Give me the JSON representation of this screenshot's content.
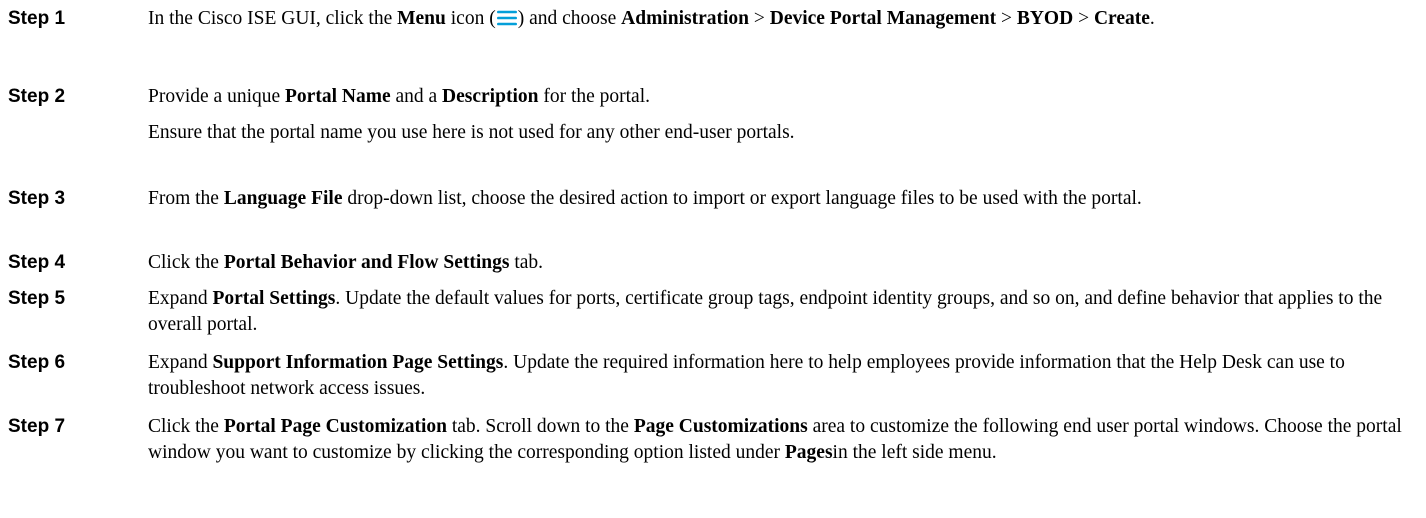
{
  "steps": [
    {
      "label": "Step 1",
      "parts": [
        {
          "t": "In the Cisco ISE GUI, click the "
        },
        {
          "t": "Menu",
          "b": true
        },
        {
          "t": " icon ("
        },
        {
          "icon": "menu-icon"
        },
        {
          "t": ") and choose "
        },
        {
          "t": "Administration",
          "b": true
        },
        {
          "t": " > "
        },
        {
          "t": "Device Portal Management",
          "b": true
        },
        {
          "t": " > "
        },
        {
          "t": "BYOD",
          "b": true
        },
        {
          "t": " > "
        },
        {
          "t": "Create",
          "b": true
        },
        {
          "t": "."
        }
      ]
    },
    {
      "label": "Step 2",
      "parts": [
        {
          "t": "Provide a unique "
        },
        {
          "t": "Portal Name",
          "b": true
        },
        {
          "t": " and a "
        },
        {
          "t": "Description",
          "b": true
        },
        {
          "t": " for the portal."
        }
      ],
      "note": "Ensure that the portal name you use here is not used for any other end-user portals."
    },
    {
      "label": "Step 3",
      "parts": [
        {
          "t": "From the "
        },
        {
          "t": "Language File",
          "b": true
        },
        {
          "t": " drop-down list, choose the desired action to import or export language files to be used with the portal."
        }
      ]
    },
    {
      "label": "Step 4",
      "parts": [
        {
          "t": "Click the "
        },
        {
          "t": "Portal Behavior and Flow Settings",
          "b": true
        },
        {
          "t": " tab."
        }
      ]
    },
    {
      "label": "Step 5",
      "parts": [
        {
          "t": "Expand "
        },
        {
          "t": "Portal Settings",
          "b": true
        },
        {
          "t": ". Update the default values for ports, certificate group tags, endpoint identity groups, and so on, and define behavior that applies to the overall portal."
        }
      ]
    },
    {
      "label": "Step 6",
      "parts": [
        {
          "t": "Expand "
        },
        {
          "t": "Support Information Page Settings",
          "b": true
        },
        {
          "t": ". Update the required information here to help employees provide information that the Help Desk can use to troubleshoot network access issues."
        }
      ]
    },
    {
      "label": "Step 7",
      "parts": [
        {
          "t": "Click the "
        },
        {
          "t": "Portal Page Customization",
          "b": true
        },
        {
          "t": " tab. Scroll down to the "
        },
        {
          "t": "Page Customizations",
          "b": true
        },
        {
          "t": " area to customize the following end user portal windows. Choose the portal window you want to customize by clicking the corresponding option listed under "
        },
        {
          "t": "Pages",
          "b": true
        },
        {
          "t": "in the left side menu."
        }
      ]
    }
  ],
  "icon_color": "#049fd9"
}
